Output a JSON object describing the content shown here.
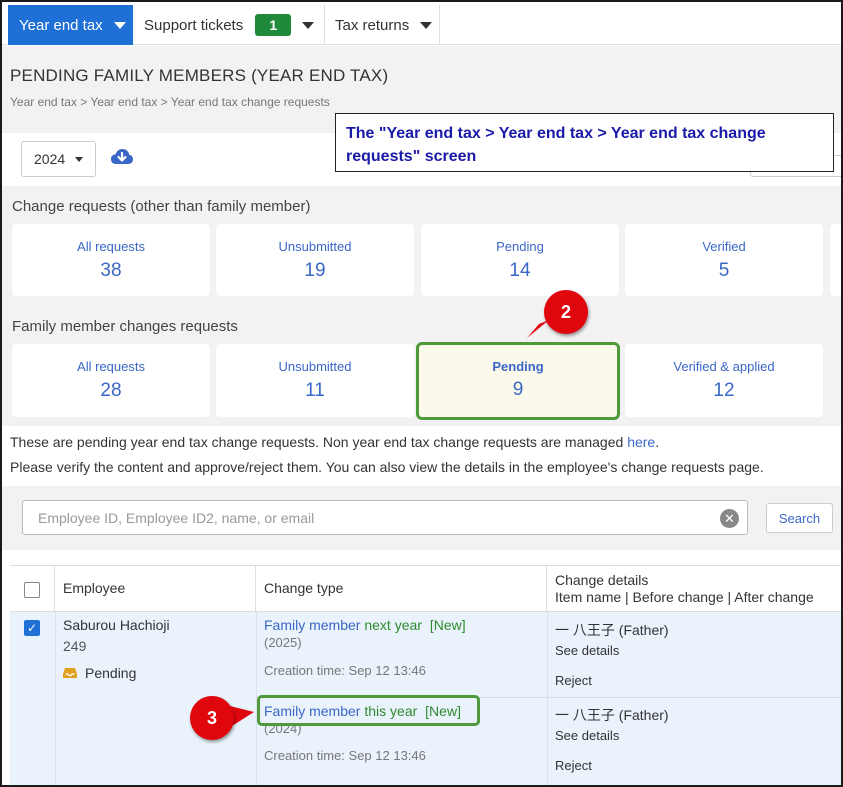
{
  "nav": {
    "tabs": [
      {
        "label": "Year end tax"
      },
      {
        "label": "Support tickets",
        "badge": "1"
      },
      {
        "label": "Tax returns"
      }
    ]
  },
  "header": {
    "title": "PENDING FAMILY MEMBERS (YEAR END TAX)",
    "breadcrumb": "Year end tax > Year end tax > Year end tax change requests"
  },
  "toolbar": {
    "year": "2024",
    "download_icon": "cloud-download-icon"
  },
  "callout": {
    "text": "The \"Year end tax > Year end tax > Year end tax change requests\" screen"
  },
  "change_requests": {
    "label": "Change requests (other than family member)",
    "cards": [
      {
        "label": "All requests",
        "value": "38"
      },
      {
        "label": "Unsubmitted",
        "value": "19"
      },
      {
        "label": "Pending",
        "value": "14"
      },
      {
        "label": "Verified",
        "value": "5"
      }
    ]
  },
  "family_requests": {
    "label": "Family member changes requests",
    "cards": [
      {
        "label": "All requests",
        "value": "28"
      },
      {
        "label": "Unsubmitted",
        "value": "11"
      },
      {
        "label": "Pending",
        "value": "9"
      },
      {
        "label": "Verified & applied",
        "value": "12"
      }
    ]
  },
  "markers": {
    "m2": "2",
    "m3": "3"
  },
  "info": {
    "line1_prefix": "These are pending year end tax change requests. Non year end tax change requests are managed ",
    "line1_link": "here",
    "line1_suffix": ".",
    "line2": "Please verify the content and approve/reject them. You can also view the details in the employee's change requests page."
  },
  "search": {
    "placeholder": "Employee ID, Employee ID2, name, or email",
    "button": "Search"
  },
  "table": {
    "headers": {
      "employee": "Employee",
      "change_type": "Change type",
      "change_details": "Change details",
      "change_details_sub": "Item name | Before change | After change"
    },
    "employee": {
      "name": "Saburou Hachioji",
      "id": "249",
      "status": "Pending"
    },
    "rows": [
      {
        "type_link": "Family member",
        "type_green": "next year",
        "tag": "[New]",
        "year": "(2025)",
        "created": "Creation time: Sep 12 13:46",
        "detail": "一 八王子 (Father)",
        "see_details": "See details",
        "reject": "Reject"
      },
      {
        "type_link": "Family member",
        "type_green": "this year",
        "tag": "[New]",
        "year": "(2024)",
        "created": "Creation time: Sep 12 13:46",
        "detail": "一 八王子 (Father)",
        "see_details": "See details",
        "reject": "Reject"
      }
    ]
  }
}
